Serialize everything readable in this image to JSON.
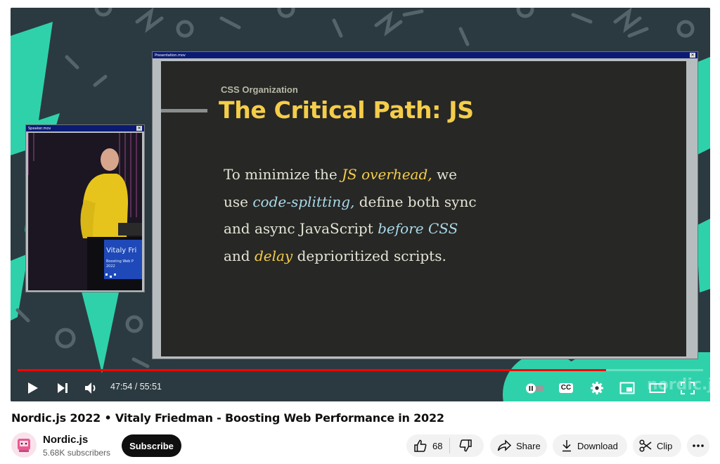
{
  "player": {
    "presentation_window_title": "Presentation.mov",
    "speaker_window_title": "Speaker.mov",
    "slide": {
      "eyebrow": "CSS Organization",
      "headline": "The Critical Path: JS",
      "line1_a": "To minimize the ",
      "line1_em": "JS overhead,",
      "line1_b": " we",
      "line2_a": "use ",
      "line2_em": "code-splitting,",
      "line2_b": " define both sync",
      "line3_a": "and async JavaScript ",
      "line3_em": "before CSS",
      "line4_em": "delay",
      "line4_a": "and ",
      "line4_b": " deprioritized scripts."
    },
    "podium_text_1": "Vitaly Fri",
    "podium_text_2": "Boosting Web P",
    "podium_text_3": "2022",
    "watermark": "nordic.js",
    "current_time": "47:54",
    "duration": "55:51",
    "time_display": "47:54 / 55:51",
    "progress_fraction": 0.858,
    "cc_label": "CC"
  },
  "video": {
    "title": "Nordic.js 2022 • Vitaly Friedman - Boosting Web Performance in 2022"
  },
  "channel": {
    "name": "Nordic.js",
    "subscribers": "5.68K subscribers",
    "subscribe_label": "Subscribe"
  },
  "actions": {
    "like_count": "68",
    "share_label": "Share",
    "download_label": "Download",
    "clip_label": "Clip"
  },
  "colors": {
    "progress": "#ff0000",
    "teal_accent": "#2fd1ab",
    "slide_yellow": "#f4cd4a",
    "slide_blue": "#a9d9e8"
  }
}
